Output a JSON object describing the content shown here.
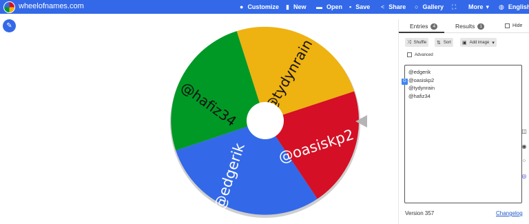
{
  "header": {
    "brand": "wheelofnames.com",
    "logo_icon": "wheel-logo-icon",
    "nav": [
      {
        "label": "Customize",
        "icon": "palette-icon"
      },
      {
        "label": "New",
        "icon": "file-icon"
      },
      {
        "label": "Open",
        "icon": "folder-icon"
      },
      {
        "label": "Save",
        "icon": "floppy-icon"
      },
      {
        "label": "Share",
        "icon": "share-icon"
      },
      {
        "label": "Gallery",
        "icon": "search-icon"
      },
      {
        "label": "",
        "icon": "fullscreen-icon"
      },
      {
        "label": "More",
        "icon": "chevron-down-icon"
      },
      {
        "label": "English",
        "icon": "globe-icon"
      }
    ],
    "bar_color": "#3369e8"
  },
  "wheel": {
    "segments": [
      {
        "label": "@edgerik",
        "color": "#3369e8"
      },
      {
        "label": "@hafiz34",
        "color": "#009925"
      },
      {
        "label": "@tydynrain",
        "color": "#eeb211"
      },
      {
        "label": "@oasiskp2",
        "color": "#d50f25"
      }
    ]
  },
  "panel": {
    "tabs": [
      {
        "label": "Entries",
        "count": "4"
      },
      {
        "label": "Results",
        "count": "1"
      }
    ],
    "hide_label": "Hide",
    "toolbar": {
      "shuffle_label": "Shuffle",
      "sort_label": "Sort",
      "add_image_label": "Add image"
    },
    "advanced_label": "Advanced",
    "entries": [
      "@edgerik",
      "@oasiskp2",
      "@tydynrain",
      "@hafiz34"
    ],
    "version": "Version 357",
    "changelog": "Changelog"
  }
}
